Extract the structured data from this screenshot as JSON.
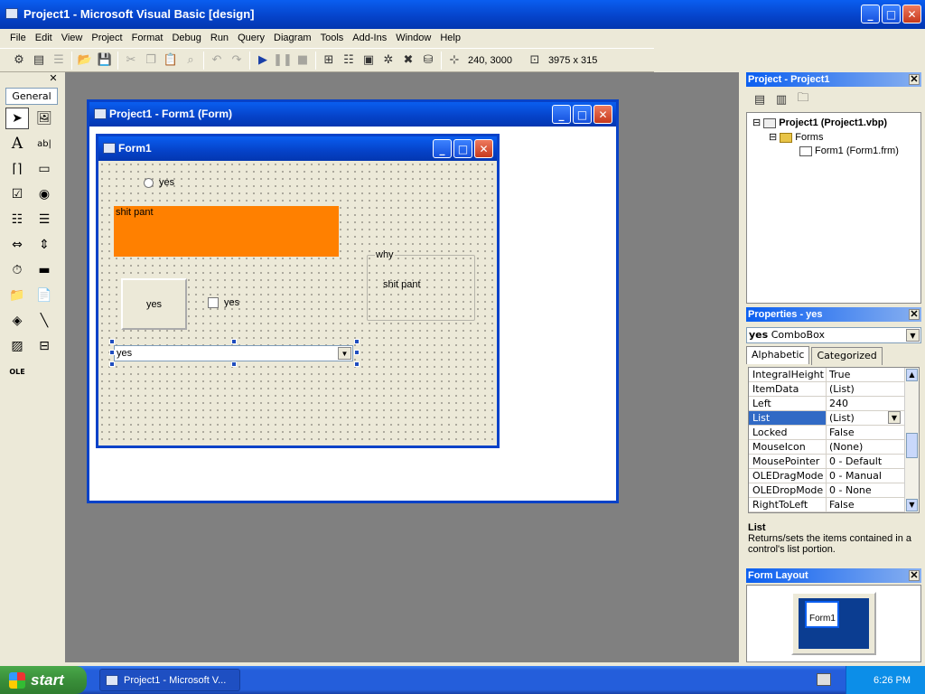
{
  "app": {
    "title": "Project1 - Microsoft Visual Basic [design]"
  },
  "menu": [
    "File",
    "Edit",
    "View",
    "Project",
    "Format",
    "Debug",
    "Run",
    "Query",
    "Diagram",
    "Tools",
    "Add-Ins",
    "Window",
    "Help"
  ],
  "toolbar": {
    "position": "240, 3000",
    "size": "3975 x 315"
  },
  "toolbox": {
    "tab_label": "General"
  },
  "designer": {
    "title": "Project1 - Form1 (Form)",
    "form_title": "Form1",
    "option_label": "yes",
    "label_text": "shit pant",
    "label_color": "#ff8000",
    "button_label": "yes",
    "checkbox_label": "yes",
    "frame_caption": "why",
    "frame_text": "shit pant",
    "combo_value": "yes"
  },
  "project_panel": {
    "title": "Project - Project1",
    "root": "Project1 (Project1.vbp)",
    "folder": "Forms",
    "item": "Form1 (Form1.frm)"
  },
  "properties_panel": {
    "title": "Properties - yes",
    "object_name": "yes",
    "object_type": "ComboBox",
    "tabs": [
      "Alphabetic",
      "Categorized"
    ],
    "rows": [
      {
        "key": "IntegralHeight",
        "value": "True"
      },
      {
        "key": "ItemData",
        "value": "(List)"
      },
      {
        "key": "Left",
        "value": "240"
      },
      {
        "key": "List",
        "value": "(List)"
      },
      {
        "key": "Locked",
        "value": "False"
      },
      {
        "key": "MouseIcon",
        "value": "(None)"
      },
      {
        "key": "MousePointer",
        "value": "0 - Default"
      },
      {
        "key": "OLEDragMode",
        "value": "0 - Manual"
      },
      {
        "key": "OLEDropMode",
        "value": "0 - None"
      },
      {
        "key": "RightToLeft",
        "value": "False"
      }
    ],
    "description_title": "List",
    "description_text": "Returns/sets the items contained in a control's list portion."
  },
  "form_layout": {
    "title": "Form Layout",
    "form_label": "Form1"
  },
  "taskbar": {
    "start_label": "start",
    "task_label": "Project1 - Microsoft V...",
    "clock": "6:26 PM"
  }
}
